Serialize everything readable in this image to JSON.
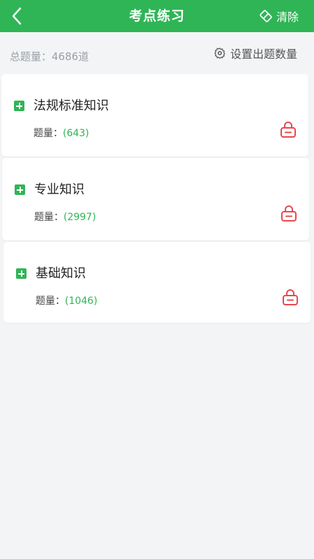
{
  "header": {
    "title": "考点练习",
    "clear_label": "清除"
  },
  "summary": {
    "total_label": "总题量：",
    "total_count": "4686",
    "total_unit": "道",
    "settings_label": "设置出题数量"
  },
  "categories": [
    {
      "title": "法规标准知识",
      "count_label": "题量：",
      "count": "(643)"
    },
    {
      "title": "专业知识",
      "count_label": "题量：",
      "count": "(2997)"
    },
    {
      "title": "基础知识",
      "count_label": "题量：",
      "count": "(1046)"
    }
  ],
  "colors": {
    "primary": "#2fb556",
    "lock": "#e5484d",
    "background": "#f3f4f6"
  },
  "icons": [
    "back-arrow-icon",
    "eraser-icon",
    "gear-icon",
    "plus-icon",
    "lock-icon"
  ]
}
